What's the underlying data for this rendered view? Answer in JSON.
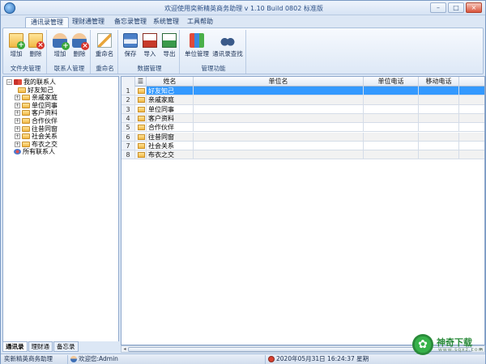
{
  "window": {
    "title": "欢迎使用奕新精英商务助理  v 1.10 Build 0802  标准版",
    "min": "–",
    "max": "□",
    "close": "×"
  },
  "ribbon_tabs": [
    "通讯录管理",
    "理财通管理",
    "备忘录管理",
    "系统管理",
    "工具帮助"
  ],
  "ribbon": {
    "groups": [
      {
        "label": "文件夹管理",
        "buttons": [
          {
            "label": "增加",
            "icon": "folder-add-icon"
          },
          {
            "label": "删除",
            "icon": "folder-delete-icon"
          }
        ]
      },
      {
        "label": "联系人管理",
        "buttons": [
          {
            "label": "增加",
            "icon": "contact-add-icon"
          },
          {
            "label": "删除",
            "icon": "contact-delete-icon"
          }
        ]
      },
      {
        "label": "重命名",
        "buttons": [
          {
            "label": "重命名",
            "icon": "rename-icon"
          }
        ]
      },
      {
        "label": "数据管理",
        "buttons": [
          {
            "label": "保存",
            "icon": "save-icon"
          },
          {
            "label": "导入",
            "icon": "import-icon"
          },
          {
            "label": "导出",
            "icon": "export-icon"
          }
        ]
      },
      {
        "label": "管理功能",
        "buttons": [
          {
            "label": "单位管理",
            "icon": "unit-manage-icon"
          },
          {
            "label": "通讯录查找",
            "icon": "binoculars-icon"
          }
        ]
      }
    ]
  },
  "tree": {
    "root": "我的联系人",
    "children": [
      "好友知己",
      "亲戚家庭",
      "单位同事",
      "客户资料",
      "合作伙伴",
      "往昔同窗",
      "社会关系",
      "布衣之交"
    ],
    "all": "所有联系人"
  },
  "bottom_tabs": [
    "通讯录",
    "理财通",
    "备忘录"
  ],
  "grid": {
    "columns": [
      "☰",
      "姓名",
      "单位名",
      "单位电话",
      "移动电话"
    ],
    "rows": [
      {
        "n": "1",
        "name": "好友知己"
      },
      {
        "n": "2",
        "name": "亲戚家庭"
      },
      {
        "n": "3",
        "name": "单位同事"
      },
      {
        "n": "4",
        "name": "客户资料"
      },
      {
        "n": "5",
        "name": "合作伙伴"
      },
      {
        "n": "6",
        "name": "往昔同窗"
      },
      {
        "n": "7",
        "name": "社会关系"
      },
      {
        "n": "8",
        "name": "布衣之交"
      }
    ]
  },
  "status": {
    "app": "奕新精英商务助理",
    "user": "欢迎您:Admin",
    "datetime": "2020年05月31日 16:24:37 星期"
  },
  "watermark": {
    "logo": "✿",
    "text": "神奇下载",
    "url": "www.sqxz.com"
  }
}
